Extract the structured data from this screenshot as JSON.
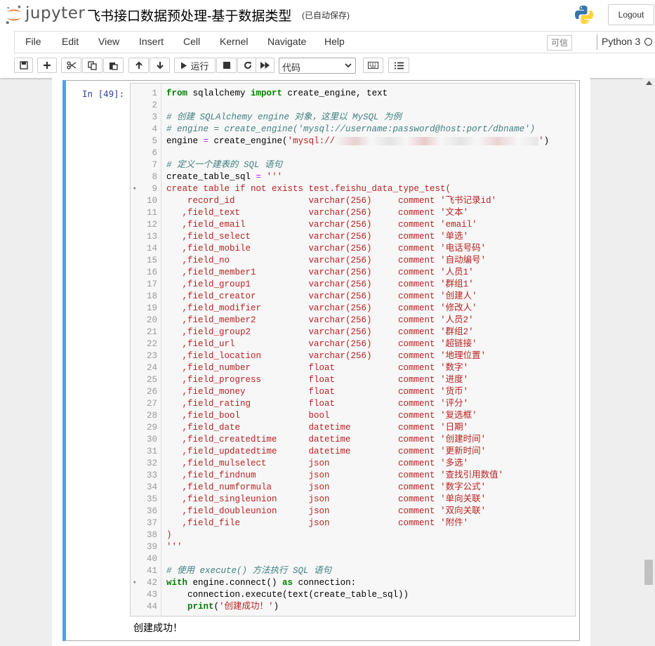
{
  "app": {
    "logo_text": "jupyter",
    "notebook_title": "飞书接口数据预处理-基于数据类型",
    "save_status": "(已自动保存)",
    "logout_label": "Logout"
  },
  "menu": {
    "items": [
      "File",
      "Edit",
      "View",
      "Insert",
      "Cell",
      "Kernel",
      "Navigate",
      "Help"
    ],
    "trusted_label": "可信",
    "kernel_name": "Python 3"
  },
  "toolbar": {
    "run_label": "运行",
    "cell_type": "代码"
  },
  "cell": {
    "prompt": "In  [49]:",
    "output": "创建成功！",
    "lines": [
      {
        "n": "1",
        "fold": "",
        "segs": [
          {
            "c": "kw",
            "t": "from"
          },
          {
            "c": "",
            "t": " sqlalchemy "
          },
          {
            "c": "kw",
            "t": "import"
          },
          {
            "c": "",
            "t": " create_engine, text"
          }
        ]
      },
      {
        "n": "2",
        "fold": "",
        "segs": []
      },
      {
        "n": "3",
        "fold": "",
        "segs": [
          {
            "c": "cm",
            "t": "# 创建 SQLAlchemy engine 对象，这里以 MySQL 为例"
          }
        ]
      },
      {
        "n": "4",
        "fold": "",
        "segs": [
          {
            "c": "cm",
            "t": "# engine = create_engine('mysql://username:password@host:port/dbname')"
          }
        ]
      },
      {
        "n": "5",
        "fold": "",
        "segs": [
          {
            "c": "",
            "t": "engine "
          },
          {
            "c": "op",
            "t": "="
          },
          {
            "c": "",
            "t": " create_engine("
          },
          {
            "c": "str",
            "t": "'mysql://"
          },
          {
            "c": "blur",
            "t": ""
          },
          {
            "c": "str",
            "t": "'"
          },
          {
            "c": "",
            "t": ")"
          }
        ]
      },
      {
        "n": "6",
        "fold": "",
        "segs": []
      },
      {
        "n": "7",
        "fold": "",
        "segs": [
          {
            "c": "cm",
            "t": "# 定义一个建表的 SQL 语句"
          }
        ]
      },
      {
        "n": "8",
        "fold": "",
        "segs": [
          {
            "c": "",
            "t": "create_table_sql "
          },
          {
            "c": "op",
            "t": "="
          },
          {
            "c": "",
            "t": " "
          },
          {
            "c": "str",
            "t": "'''"
          }
        ]
      },
      {
        "n": "9",
        "fold": "▾",
        "segs": [
          {
            "c": "str",
            "t": "create table if not exists test.feishu_data_type_test("
          }
        ]
      },
      {
        "n": "10",
        "fold": "",
        "segs": [
          {
            "c": "str",
            "t": "    record_id              varchar(256)     comment '飞书记录id'"
          }
        ]
      },
      {
        "n": "11",
        "fold": "",
        "segs": [
          {
            "c": "str",
            "t": "   ,field_text             varchar(256)     comment '文本'"
          }
        ]
      },
      {
        "n": "12",
        "fold": "",
        "segs": [
          {
            "c": "str",
            "t": "   ,field_email            varchar(256)     comment 'email'"
          }
        ]
      },
      {
        "n": "13",
        "fold": "",
        "segs": [
          {
            "c": "str",
            "t": "   ,field_select           varchar(256)     comment '单选'"
          }
        ]
      },
      {
        "n": "14",
        "fold": "",
        "segs": [
          {
            "c": "str",
            "t": "   ,field_mobile           varchar(256)     comment '电话号码'"
          }
        ]
      },
      {
        "n": "15",
        "fold": "",
        "segs": [
          {
            "c": "str",
            "t": "   ,field_no               varchar(256)     comment '自动编号'"
          }
        ]
      },
      {
        "n": "16",
        "fold": "",
        "segs": [
          {
            "c": "str",
            "t": "   ,field_member1          varchar(256)     comment '人员1'"
          }
        ]
      },
      {
        "n": "17",
        "fold": "",
        "segs": [
          {
            "c": "str",
            "t": "   ,field_group1           varchar(256)     comment '群组1'"
          }
        ]
      },
      {
        "n": "18",
        "fold": "",
        "segs": [
          {
            "c": "str",
            "t": "   ,field_creator          varchar(256)     comment '创建人'"
          }
        ]
      },
      {
        "n": "19",
        "fold": "",
        "segs": [
          {
            "c": "str",
            "t": "   ,field_modifier         varchar(256)     comment '修改人'"
          }
        ]
      },
      {
        "n": "20",
        "fold": "",
        "segs": [
          {
            "c": "str",
            "t": "   ,field_member2          varchar(256)     comment '人员2'"
          }
        ]
      },
      {
        "n": "21",
        "fold": "",
        "segs": [
          {
            "c": "str",
            "t": "   ,field_group2           varchar(256)     comment '群组2'"
          }
        ]
      },
      {
        "n": "22",
        "fold": "",
        "segs": [
          {
            "c": "str",
            "t": "   ,field_url              varchar(256)     comment '超链接'"
          }
        ]
      },
      {
        "n": "23",
        "fold": "",
        "segs": [
          {
            "c": "str",
            "t": "   ,field_location         varchar(256)     comment '地理位置'"
          }
        ]
      },
      {
        "n": "24",
        "fold": "",
        "segs": [
          {
            "c": "str",
            "t": "   ,field_number           float            comment '数字'"
          }
        ]
      },
      {
        "n": "25",
        "fold": "",
        "segs": [
          {
            "c": "str",
            "t": "   ,field_progress         float            comment '进度'"
          }
        ]
      },
      {
        "n": "26",
        "fold": "",
        "segs": [
          {
            "c": "str",
            "t": "   ,field_money            float            comment '货币'"
          }
        ]
      },
      {
        "n": "27",
        "fold": "",
        "segs": [
          {
            "c": "str",
            "t": "   ,field_rating           float            comment '评分'"
          }
        ]
      },
      {
        "n": "28",
        "fold": "",
        "segs": [
          {
            "c": "str",
            "t": "   ,field_bool             bool             comment '复选框'"
          }
        ]
      },
      {
        "n": "29",
        "fold": "",
        "segs": [
          {
            "c": "str",
            "t": "   ,field_date             datetime         comment '日期'"
          }
        ]
      },
      {
        "n": "30",
        "fold": "",
        "segs": [
          {
            "c": "str",
            "t": "   ,field_createdtime      datetime         comment '创建时间'"
          }
        ]
      },
      {
        "n": "31",
        "fold": "",
        "segs": [
          {
            "c": "str",
            "t": "   ,field_updatedtime      datetime         comment '更新时间'"
          }
        ]
      },
      {
        "n": "32",
        "fold": "",
        "segs": [
          {
            "c": "str",
            "t": "   ,field_mulselect        json             comment '多选'"
          }
        ]
      },
      {
        "n": "33",
        "fold": "",
        "segs": [
          {
            "c": "str",
            "t": "   ,field_findnum          json             comment '查找引用数值'"
          }
        ]
      },
      {
        "n": "34",
        "fold": "",
        "segs": [
          {
            "c": "str",
            "t": "   ,field_numformula       json             comment '数字公式'"
          }
        ]
      },
      {
        "n": "35",
        "fold": "",
        "segs": [
          {
            "c": "str",
            "t": "   ,field_singleunion      json             comment '单向关联'"
          }
        ]
      },
      {
        "n": "36",
        "fold": "",
        "segs": [
          {
            "c": "str",
            "t": "   ,field_doubleunion      json             comment '双向关联'"
          }
        ]
      },
      {
        "n": "37",
        "fold": "",
        "segs": [
          {
            "c": "str",
            "t": "   ,field_file             json             comment '附件'"
          }
        ]
      },
      {
        "n": "38",
        "fold": "",
        "segs": [
          {
            "c": "str",
            "t": ")"
          }
        ]
      },
      {
        "n": "39",
        "fold": "",
        "segs": [
          {
            "c": "str",
            "t": "'''"
          }
        ]
      },
      {
        "n": "40",
        "fold": "",
        "segs": []
      },
      {
        "n": "41",
        "fold": "",
        "segs": [
          {
            "c": "cm",
            "t": "# 使用 execute() 方法执行 SQL 语句"
          }
        ]
      },
      {
        "n": "42",
        "fold": "▾",
        "segs": [
          {
            "c": "kw",
            "t": "with"
          },
          {
            "c": "",
            "t": " engine.connect() "
          },
          {
            "c": "kw",
            "t": "as"
          },
          {
            "c": "",
            "t": " connection:"
          }
        ]
      },
      {
        "n": "43",
        "fold": "",
        "segs": [
          {
            "c": "",
            "t": "    connection.execute(text(create_table_sql))"
          }
        ]
      },
      {
        "n": "44",
        "fold": "",
        "segs": [
          {
            "c": "",
            "t": "    "
          },
          {
            "c": "kw",
            "t": "print"
          },
          {
            "c": "",
            "t": "("
          },
          {
            "c": "str",
            "t": "'创建成功！'"
          },
          {
            "c": "",
            "t": ")"
          }
        ]
      }
    ]
  },
  "colors": {
    "cell_border_active": "#42a5f5",
    "prompt": "#303f9f",
    "keyword": "#008000",
    "string": "#ba2121",
    "comment": "#408080",
    "operator": "#aa22ff"
  },
  "icons": [
    "jupyter-logo-icon",
    "python-logo-icon",
    "save-icon",
    "plus-icon",
    "cut-icon",
    "copy-icon",
    "paste-icon",
    "arrow-up-icon",
    "arrow-down-icon",
    "run-icon",
    "stop-icon",
    "restart-icon",
    "fast-forward-icon",
    "keyboard-icon",
    "list-icon",
    "kernel-idle-icon"
  ]
}
